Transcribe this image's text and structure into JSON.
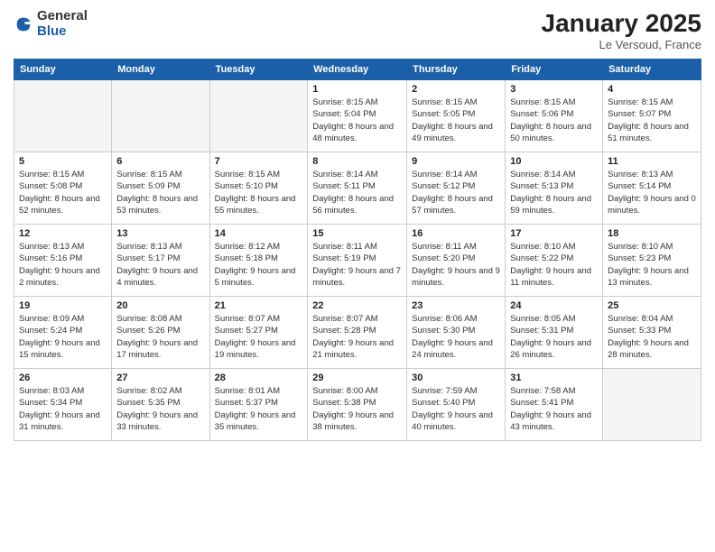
{
  "header": {
    "logo_general": "General",
    "logo_blue": "Blue",
    "month_title": "January 2025",
    "location": "Le Versoud, France"
  },
  "weekdays": [
    "Sunday",
    "Monday",
    "Tuesday",
    "Wednesday",
    "Thursday",
    "Friday",
    "Saturday"
  ],
  "weeks": [
    [
      {
        "day": "",
        "empty": true
      },
      {
        "day": "",
        "empty": true
      },
      {
        "day": "",
        "empty": true
      },
      {
        "day": "1",
        "sunrise": "8:15 AM",
        "sunset": "5:04 PM",
        "daylight": "8 hours and 48 minutes."
      },
      {
        "day": "2",
        "sunrise": "8:15 AM",
        "sunset": "5:05 PM",
        "daylight": "8 hours and 49 minutes."
      },
      {
        "day": "3",
        "sunrise": "8:15 AM",
        "sunset": "5:06 PM",
        "daylight": "8 hours and 50 minutes."
      },
      {
        "day": "4",
        "sunrise": "8:15 AM",
        "sunset": "5:07 PM",
        "daylight": "8 hours and 51 minutes."
      }
    ],
    [
      {
        "day": "5",
        "sunrise": "8:15 AM",
        "sunset": "5:08 PM",
        "daylight": "8 hours and 52 minutes."
      },
      {
        "day": "6",
        "sunrise": "8:15 AM",
        "sunset": "5:09 PM",
        "daylight": "8 hours and 53 minutes."
      },
      {
        "day": "7",
        "sunrise": "8:15 AM",
        "sunset": "5:10 PM",
        "daylight": "8 hours and 55 minutes."
      },
      {
        "day": "8",
        "sunrise": "8:14 AM",
        "sunset": "5:11 PM",
        "daylight": "8 hours and 56 minutes."
      },
      {
        "day": "9",
        "sunrise": "8:14 AM",
        "sunset": "5:12 PM",
        "daylight": "8 hours and 57 minutes."
      },
      {
        "day": "10",
        "sunrise": "8:14 AM",
        "sunset": "5:13 PM",
        "daylight": "8 hours and 59 minutes."
      },
      {
        "day": "11",
        "sunrise": "8:13 AM",
        "sunset": "5:14 PM",
        "daylight": "9 hours and 0 minutes."
      }
    ],
    [
      {
        "day": "12",
        "sunrise": "8:13 AM",
        "sunset": "5:16 PM",
        "daylight": "9 hours and 2 minutes."
      },
      {
        "day": "13",
        "sunrise": "8:13 AM",
        "sunset": "5:17 PM",
        "daylight": "9 hours and 4 minutes."
      },
      {
        "day": "14",
        "sunrise": "8:12 AM",
        "sunset": "5:18 PM",
        "daylight": "9 hours and 5 minutes."
      },
      {
        "day": "15",
        "sunrise": "8:11 AM",
        "sunset": "5:19 PM",
        "daylight": "9 hours and 7 minutes."
      },
      {
        "day": "16",
        "sunrise": "8:11 AM",
        "sunset": "5:20 PM",
        "daylight": "9 hours and 9 minutes."
      },
      {
        "day": "17",
        "sunrise": "8:10 AM",
        "sunset": "5:22 PM",
        "daylight": "9 hours and 11 minutes."
      },
      {
        "day": "18",
        "sunrise": "8:10 AM",
        "sunset": "5:23 PM",
        "daylight": "9 hours and 13 minutes."
      }
    ],
    [
      {
        "day": "19",
        "sunrise": "8:09 AM",
        "sunset": "5:24 PM",
        "daylight": "9 hours and 15 minutes."
      },
      {
        "day": "20",
        "sunrise": "8:08 AM",
        "sunset": "5:26 PM",
        "daylight": "9 hours and 17 minutes."
      },
      {
        "day": "21",
        "sunrise": "8:07 AM",
        "sunset": "5:27 PM",
        "daylight": "9 hours and 19 minutes."
      },
      {
        "day": "22",
        "sunrise": "8:07 AM",
        "sunset": "5:28 PM",
        "daylight": "9 hours and 21 minutes."
      },
      {
        "day": "23",
        "sunrise": "8:06 AM",
        "sunset": "5:30 PM",
        "daylight": "9 hours and 24 minutes."
      },
      {
        "day": "24",
        "sunrise": "8:05 AM",
        "sunset": "5:31 PM",
        "daylight": "9 hours and 26 minutes."
      },
      {
        "day": "25",
        "sunrise": "8:04 AM",
        "sunset": "5:33 PM",
        "daylight": "9 hours and 28 minutes."
      }
    ],
    [
      {
        "day": "26",
        "sunrise": "8:03 AM",
        "sunset": "5:34 PM",
        "daylight": "9 hours and 31 minutes."
      },
      {
        "day": "27",
        "sunrise": "8:02 AM",
        "sunset": "5:35 PM",
        "daylight": "9 hours and 33 minutes."
      },
      {
        "day": "28",
        "sunrise": "8:01 AM",
        "sunset": "5:37 PM",
        "daylight": "9 hours and 35 minutes."
      },
      {
        "day": "29",
        "sunrise": "8:00 AM",
        "sunset": "5:38 PM",
        "daylight": "9 hours and 38 minutes."
      },
      {
        "day": "30",
        "sunrise": "7:59 AM",
        "sunset": "5:40 PM",
        "daylight": "9 hours and 40 minutes."
      },
      {
        "day": "31",
        "sunrise": "7:58 AM",
        "sunset": "5:41 PM",
        "daylight": "9 hours and 43 minutes."
      },
      {
        "day": "",
        "empty": true
      }
    ]
  ]
}
